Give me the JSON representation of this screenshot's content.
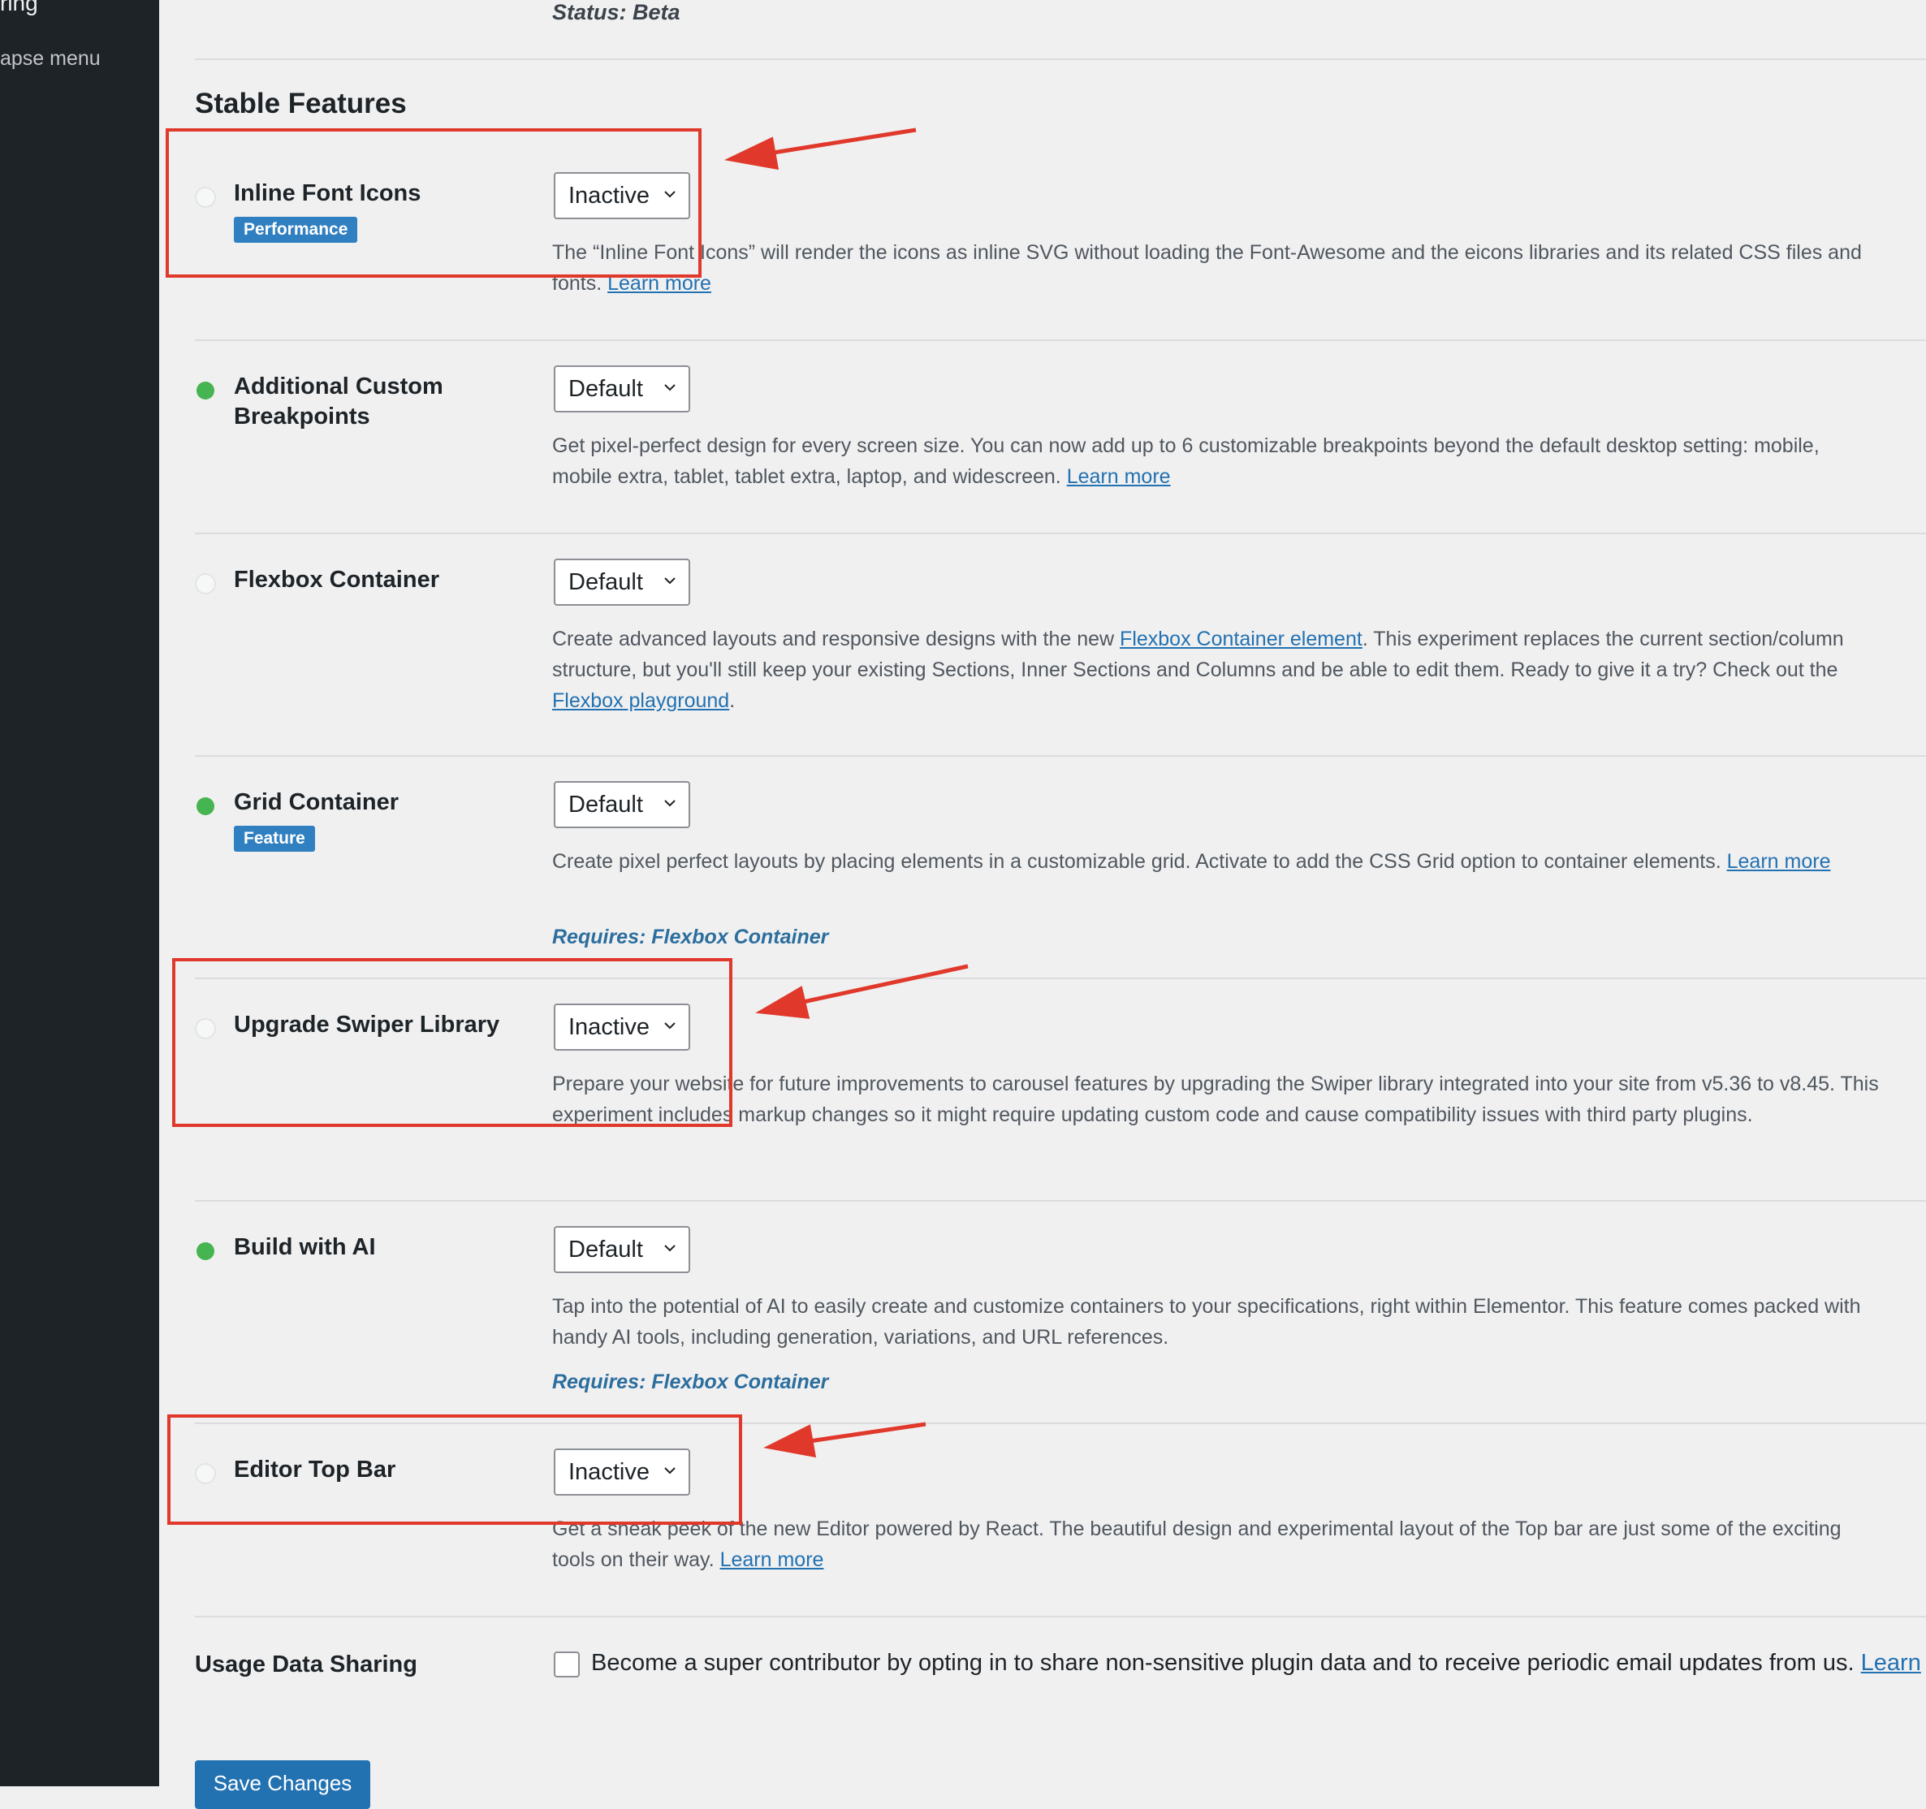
{
  "sidebar": {
    "item_partial_1": "ring",
    "item_partial_2": "apse menu"
  },
  "status_beta": "Status: Beta",
  "section_title": "Stable Features",
  "features": [
    {
      "name": "Inline Font Icons",
      "badge": "Performance",
      "state": "Inactive",
      "active": false,
      "desc": "The “Inline Font Icons” will render the icons as inline SVG without loading the Font-Awesome and the eicons libraries and its related CSS files and fonts.",
      "link": "Learn more"
    },
    {
      "name": "Additional Custom Breakpoints",
      "badge": "",
      "state": "Default",
      "active": true,
      "desc": "Get pixel-perfect design for every screen size. You can now add up to 6 customizable breakpoints beyond the default desktop setting: mobile, mobile extra, tablet, tablet extra, laptop, and widescreen.",
      "link": "Learn more"
    },
    {
      "name": "Flexbox Container",
      "badge": "",
      "state": "Default",
      "active": false,
      "desc_1": "Create advanced layouts and responsive designs with the new",
      "link_1": "Flexbox Container element",
      "desc_2": ". This experiment replaces the current section/column structure, but you'll still keep your existing Sections, Inner Sections and Columns and be able to edit them. Ready to give it a try? Check out the",
      "link_2": "Flexbox playground",
      "desc_3": "."
    },
    {
      "name": "Grid Container",
      "badge": "Feature",
      "state": "Default",
      "active": true,
      "desc": "Create pixel perfect layouts by placing elements in a customizable grid. Activate to add the CSS Grid option to container elements.",
      "link": "Learn more",
      "requires": "Requires: Flexbox Container"
    },
    {
      "name": "Upgrade Swiper Library",
      "badge": "",
      "state": "Inactive",
      "active": false,
      "desc": "Prepare your website for future improvements to carousel features by upgrading the Swiper library integrated into your site from v5.36 to v8.45. This experiment includes markup changes so it might require updating custom code and cause compatibility issues with third party plugins."
    },
    {
      "name": "Build with AI",
      "badge": "",
      "state": "Default",
      "active": true,
      "desc": "Tap into the potential of AI to easily create and customize containers to your specifications, right within Elementor. This feature comes packed with handy AI tools, including generation, variations, and URL references.",
      "requires": "Requires: Flexbox Container"
    },
    {
      "name": "Editor Top Bar",
      "badge": "",
      "state": "Inactive",
      "active": false,
      "desc": "Get a sneak peek of the new Editor powered by React. The beautiful design and experimental layout of the Top bar are just some of the exciting tools on their way.",
      "link": "Learn more"
    }
  ],
  "usage_data": {
    "label": "Usage Data Sharing",
    "text": "Become a super contributor by opting in to share non-sensitive plugin data and to receive periodic email updates from us.",
    "link": "Learn"
  },
  "save_button": "Save Changes",
  "colors": {
    "annotation": "#e0392b",
    "active_dot": "#46b450",
    "badge": "#2f7fc1",
    "link": "#2271b1"
  }
}
